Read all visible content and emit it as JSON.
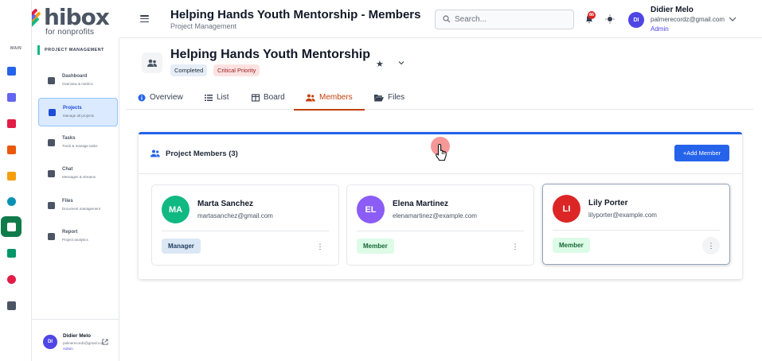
{
  "app": {
    "logo_word": "hibox",
    "logo_sub": "for nonprofits",
    "colors": {
      "accent": "#2563eb",
      "brand_green": "#0f7b4b",
      "active_tab": "#c2410c"
    }
  },
  "rail": {
    "section_label": "MAIN",
    "items": [
      {
        "name": "home-icon",
        "color": "#2563eb"
      },
      {
        "name": "org-chart-icon",
        "color": "#6366f1"
      },
      {
        "name": "handshake-icon",
        "color": "#e11d48"
      },
      {
        "name": "book-icon",
        "color": "#ea580c"
      },
      {
        "name": "graduation-cap-icon",
        "color": "#f59e0b"
      },
      {
        "name": "globe-icon",
        "color": "#0891b2"
      },
      {
        "name": "projects-icon",
        "color": "#ffffff",
        "active": true
      },
      {
        "name": "users-icon",
        "color": "#059669"
      },
      {
        "name": "chart-pie-icon",
        "color": "#e11d48"
      },
      {
        "name": "gear-icon",
        "color": "#4b5563"
      }
    ]
  },
  "sidebar": {
    "section_title": "PROJECT MANAGEMENT",
    "items": [
      {
        "label": "Dashboard",
        "desc": "Overview & metrics",
        "icon": "dashboard-icon"
      },
      {
        "label": "Projects",
        "desc": "Manage all projects",
        "icon": "projects-icon",
        "active": true
      },
      {
        "label": "Tasks",
        "desc": "Track & manage tasks",
        "icon": "tasks-icon"
      },
      {
        "label": "Chat",
        "desc": "Messages & streams",
        "icon": "chat-icon"
      },
      {
        "label": "Files",
        "desc": "Document management",
        "icon": "folder-icon"
      },
      {
        "label": "Report",
        "desc": "Project analytics",
        "icon": "report-icon"
      }
    ],
    "user": {
      "initials": "DI",
      "name": "Didier Melo",
      "email": "palmerecordz@gmail.com",
      "role": "Admin"
    }
  },
  "header": {
    "title": "Helping Hands Youth Mentorship - Members",
    "subtitle": "Project Management",
    "search_placeholder": "Search...",
    "notifications_count": "86",
    "user": {
      "initials": "DI",
      "name": "Didier Melo",
      "email": "palmerecordz@gmail.com",
      "role": "Admin"
    }
  },
  "project": {
    "name": "Helping Hands Youth Mentorship",
    "status": "Completed",
    "priority": "Critical Priority"
  },
  "tabs": [
    {
      "label": "Overview",
      "icon": "info-icon"
    },
    {
      "label": "List",
      "icon": "list-icon"
    },
    {
      "label": "Board",
      "icon": "board-icon"
    },
    {
      "label": "Members",
      "icon": "users-icon",
      "active": true
    },
    {
      "label": "Files",
      "icon": "folder-open-icon"
    }
  ],
  "members_panel": {
    "title": "Project Members (3)",
    "add_button": "+Add Member",
    "members": [
      {
        "initials": "MA",
        "name": "Marta Sanchez",
        "email": "martasanchez@gmail.com",
        "role": "Manager",
        "avatar_color": "#10b981",
        "role_bg": "#dbe7f5",
        "role_fg": "#1e3a5f"
      },
      {
        "initials": "EL",
        "name": "Elena Martinez",
        "email": "elenamartinez@example.com",
        "role": "Member",
        "avatar_color": "#8b5cf6",
        "role_bg": "#dcfce7",
        "role_fg": "#166534"
      },
      {
        "initials": "LI",
        "name": "Lily Porter",
        "email": "lilyporter@example.com",
        "role": "Member",
        "avatar_color": "#dc2626",
        "role_bg": "#dcfce7",
        "role_fg": "#166534"
      }
    ]
  }
}
